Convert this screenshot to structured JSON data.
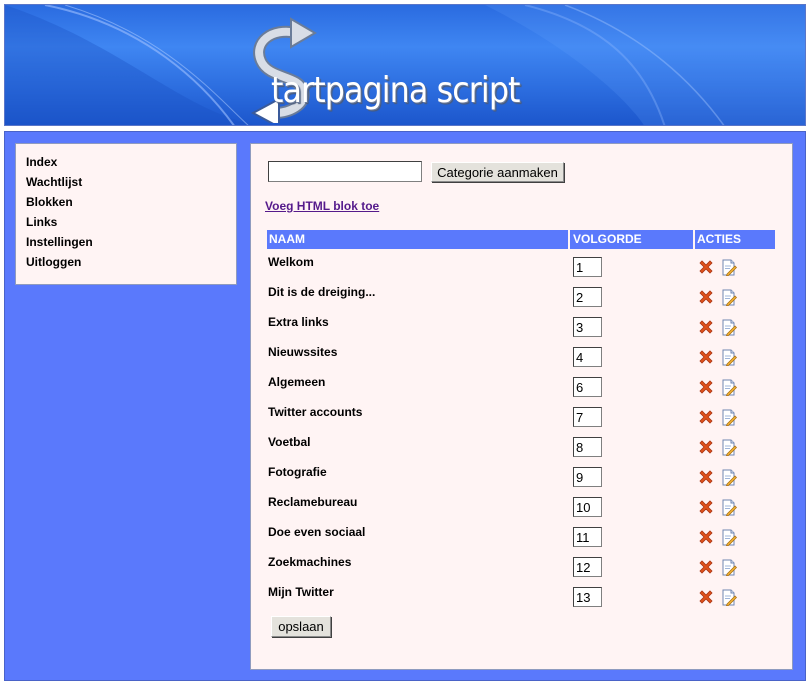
{
  "header": {
    "logo_text": "tartpagina script"
  },
  "sidebar": {
    "items": [
      {
        "label": "Index"
      },
      {
        "label": "Wachtlijst"
      },
      {
        "label": "Blokken"
      },
      {
        "label": "Links"
      },
      {
        "label": "Instellingen"
      },
      {
        "label": "Uitloggen"
      }
    ]
  },
  "category_form": {
    "input_value": "",
    "button_label": "Categorie aanmaken"
  },
  "html_block_link": "Voeg HTML blok toe",
  "table": {
    "headers": {
      "name": "NAAM",
      "order": "VOLGORDE",
      "actions": "ACTIES"
    },
    "rows": [
      {
        "name": "Welkom",
        "order": "1"
      },
      {
        "name": "Dit is de dreiging...",
        "order": "2"
      },
      {
        "name": "Extra links",
        "order": "3"
      },
      {
        "name": "Nieuwssites",
        "order": "4"
      },
      {
        "name": "Algemeen",
        "order": "6"
      },
      {
        "name": "Twitter accounts",
        "order": "7"
      },
      {
        "name": "Voetbal",
        "order": "8"
      },
      {
        "name": "Fotografie",
        "order": "9"
      },
      {
        "name": "Reclamebureau",
        "order": "10"
      },
      {
        "name": "Doe even sociaal",
        "order": "11"
      },
      {
        "name": "Zoekmachines",
        "order": "12"
      },
      {
        "name": "Mijn Twitter",
        "order": "13"
      }
    ]
  },
  "save_button": "opslaan",
  "icons": {
    "delete": "delete-x-icon",
    "edit": "edit-document-icon"
  },
  "colors": {
    "accent": "#5a79fc",
    "panel": "#fff4f4",
    "delete": "#e0531c"
  }
}
